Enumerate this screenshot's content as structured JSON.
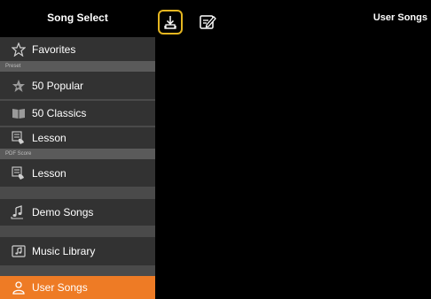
{
  "header": {
    "sidebar_title": "Song Select",
    "main_title": "User Songs",
    "download_icon": "download-icon",
    "edit_icon": "edit-icon",
    "accent": "#e5b620"
  },
  "sidebar": {
    "favorites_label": "Favorites",
    "preset_section": "Preset",
    "popular_label": "50 Popular",
    "classics_label": "50 Classics",
    "lesson_label": "Lesson",
    "pdf_section": "PDF Score",
    "pdf_lesson_label": "Lesson",
    "demo_label": "Demo Songs",
    "library_label": "Music Library",
    "user_songs_label": "User Songs",
    "active_color": "#ee7b25"
  }
}
